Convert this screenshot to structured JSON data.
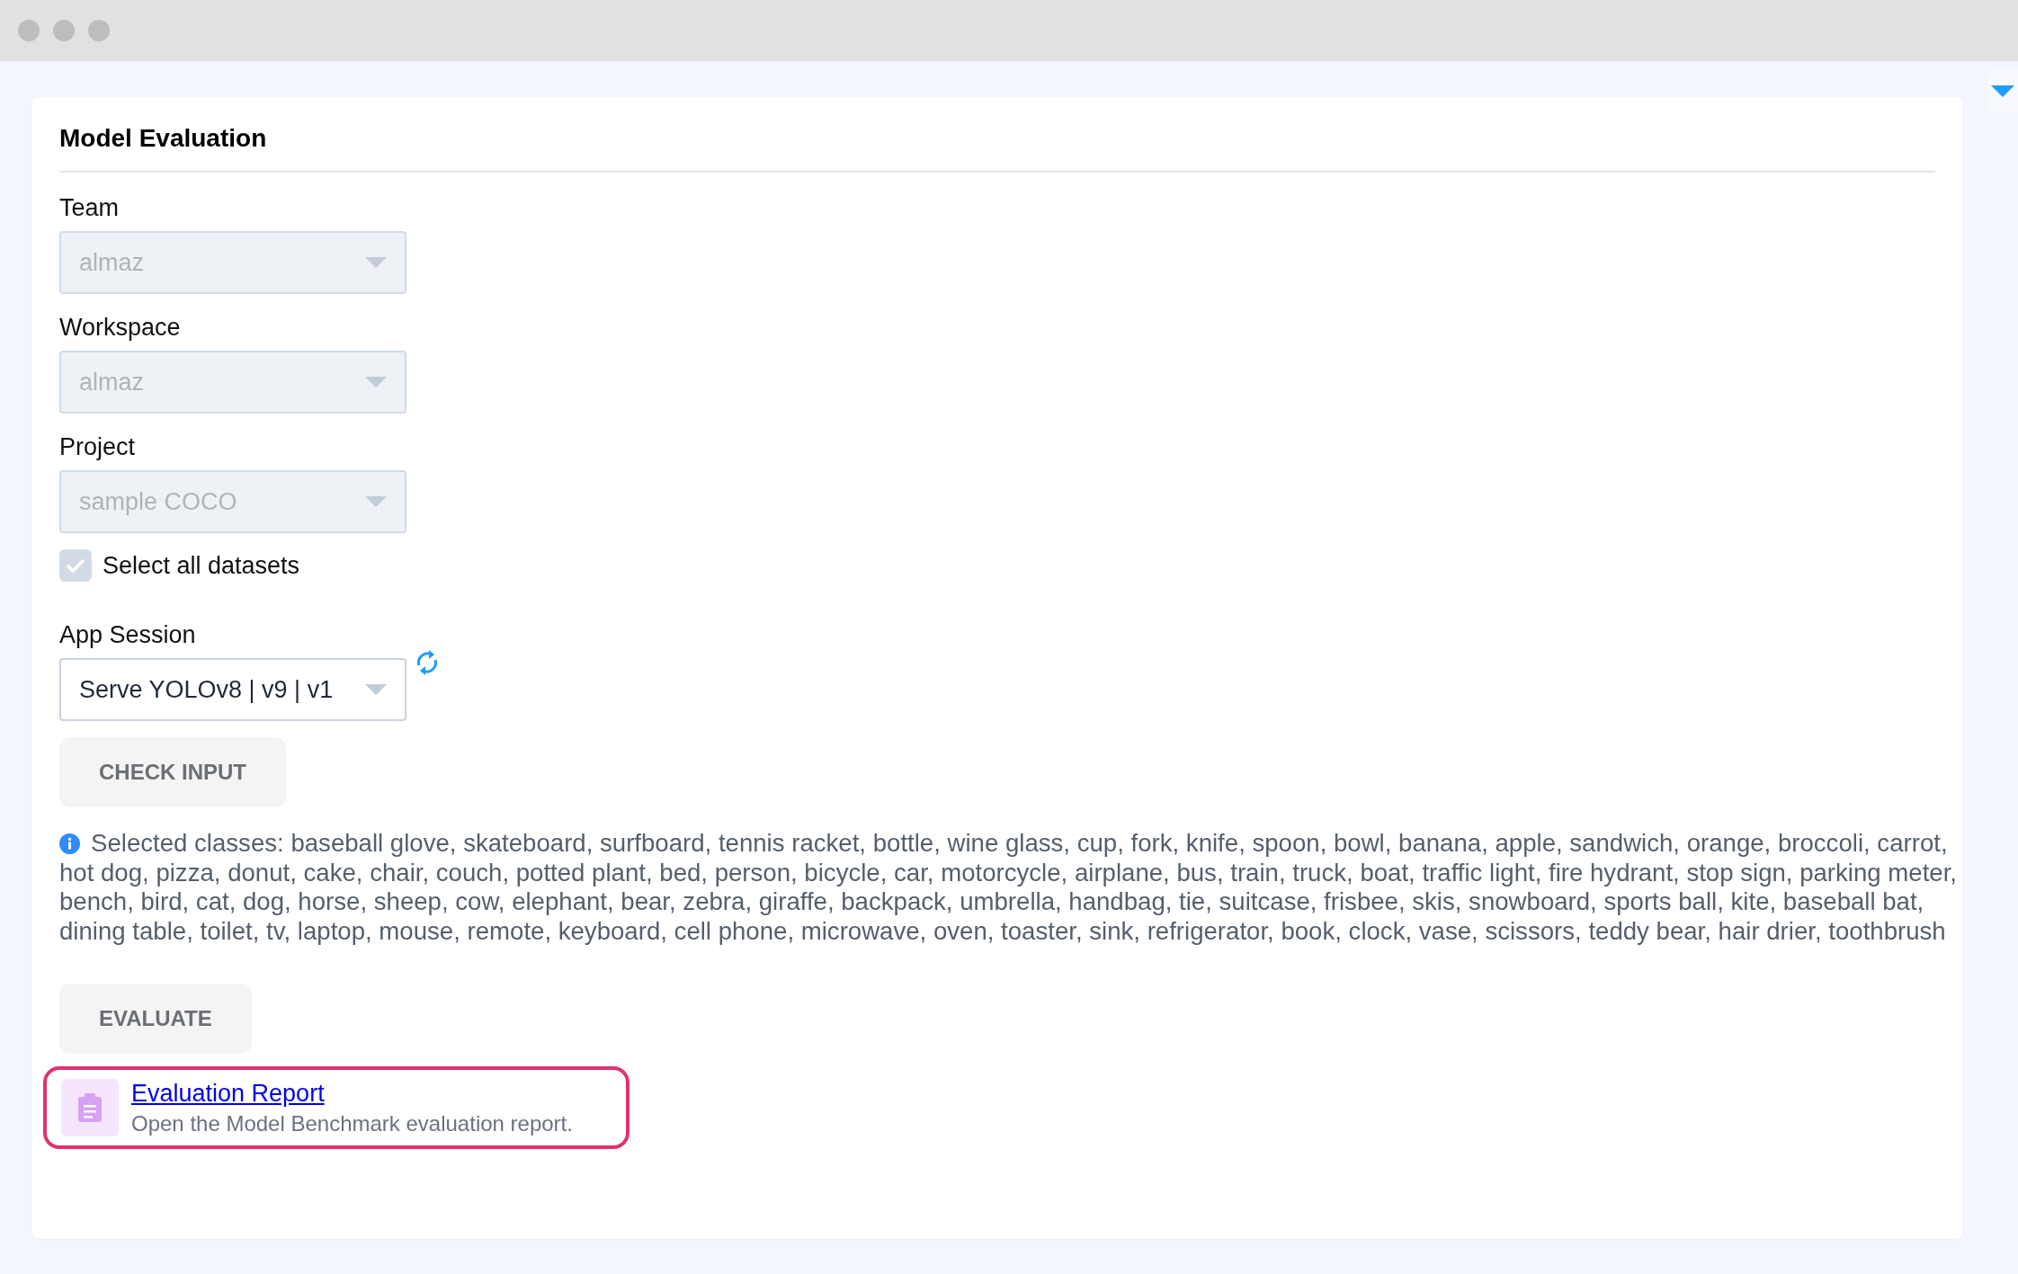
{
  "panel": {
    "title": "Model Evaluation"
  },
  "fields": [
    {
      "label": "Team",
      "value": "almaz",
      "disabled": true
    },
    {
      "label": "Workspace",
      "value": "almaz",
      "disabled": true
    },
    {
      "label": "Project",
      "value": "sample COCO",
      "disabled": true
    }
  ],
  "select_all_datasets": {
    "label": "Select all datasets",
    "checked": true,
    "disabled": true
  },
  "app_session": {
    "label": "App Session",
    "value": "Serve YOLOv8 | v9 | v1",
    "disabled": false
  },
  "check_button": {
    "label": "CHECK INPUT"
  },
  "info": {
    "text": "Selected classes: baseball glove, skateboard, surfboard, tennis racket, bottle, wine glass, cup, fork, knife, spoon, bowl, banana, apple, sandwich, orange, broccoli, carrot, hot dog, pizza, donut, cake, chair, couch, potted plant, bed, person, bicycle, car, motorcycle, airplane, bus, train, truck, boat, traffic light, fire hydrant, stop sign, parking meter, bench, bird, cat, dog, horse, sheep, cow, elephant, bear, zebra, giraffe, backpack, umbrella, handbag, tie, suitcase, frisbee, skis, snowboard, sports ball, kite, baseball bat, dining table, toilet, tv, laptop, mouse, remote, keyboard, cell phone, microwave, oven, toaster, sink, refrigerator, book, clock, vase, scissors, teddy bear, hair drier, toothbrush"
  },
  "evaluate_button": {
    "label": "EVALUATE"
  },
  "report": {
    "title": "Evaluation Report",
    "description": "Open the Model Benchmark evaluation report.",
    "highlighted": true
  }
}
